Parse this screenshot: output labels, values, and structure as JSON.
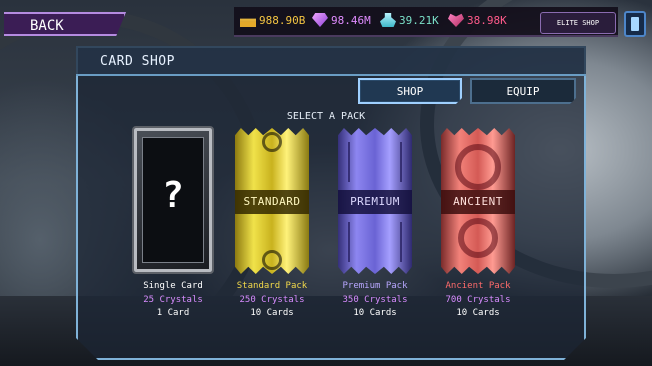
{
  "topbar": {
    "back_label": "BACK",
    "resources": [
      {
        "icon": "gold-bars-icon",
        "value": "988.90B",
        "color": "#f4c542"
      },
      {
        "icon": "gem-icon",
        "value": "98.46M",
        "color": "#e08cff"
      },
      {
        "icon": "vial-icon",
        "value": "39.21K",
        "color": "#7be0c8"
      },
      {
        "icon": "heart-gem-icon",
        "value": "38.98K",
        "color": "#ff5a8a"
      }
    ],
    "elite_shop_label": "ELITE SHOP",
    "phone_icon": "phone-icon"
  },
  "panel": {
    "title": "CARD SHOP",
    "tabs": [
      {
        "label": "SHOP",
        "active": true
      },
      {
        "label": "EQUIP",
        "active": false
      }
    ],
    "select_label": "SELECT A PACK"
  },
  "packs": [
    {
      "name": "Single Card",
      "price": "25 Crystals",
      "count": "1 Card",
      "band": "",
      "symbol": "?",
      "name_color": "#ffffff",
      "price_color": "#d88cff"
    },
    {
      "name": "Standard Pack",
      "price": "250 Crystals",
      "count": "10 Cards",
      "band": "STANDARD",
      "name_color": "#f2d94a",
      "price_color": "#d88cff"
    },
    {
      "name": "Premium Pack",
      "price": "350 Crystals",
      "count": "10 Cards",
      "band": "PREMIUM",
      "name_color": "#b8a7ff",
      "price_color": "#d88cff"
    },
    {
      "name": "Ancient Pack",
      "price": "700 Crystals",
      "count": "10 Cards",
      "band": "ANCIENT",
      "name_color": "#ff6b6b",
      "price_color": "#d88cff"
    }
  ]
}
